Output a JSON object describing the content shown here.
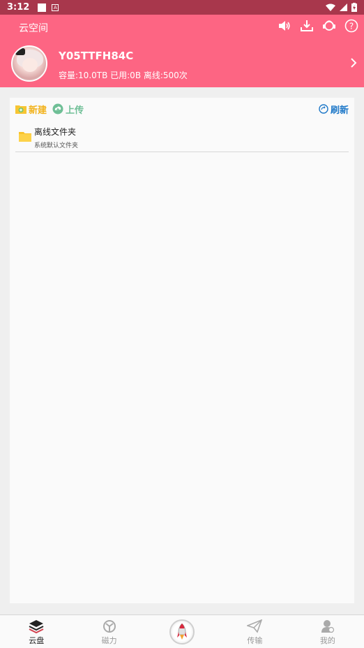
{
  "status_bar": {
    "time": "3:12",
    "badge": "A"
  },
  "header": {
    "title": "云空间",
    "username": "Y05TTFH84C",
    "quota": "容量:10.0TB 已用:0B 离线:500次"
  },
  "toolbar": {
    "new_label": "新建",
    "upload_label": "上传",
    "refresh_label": "刷新"
  },
  "files": [
    {
      "name": "离线文件夹",
      "desc": "系统默认文件夹"
    }
  ],
  "bottom_nav": {
    "items": [
      {
        "label": "云盘"
      },
      {
        "label": "磁力"
      },
      {
        "label": ""
      },
      {
        "label": "传输"
      },
      {
        "label": "我的"
      }
    ]
  },
  "colors": {
    "header": "#fd6583",
    "status_bar": "#a8374c",
    "new": "#f2b21b",
    "upload": "#6fbf96",
    "refresh": "#1e78c8"
  }
}
